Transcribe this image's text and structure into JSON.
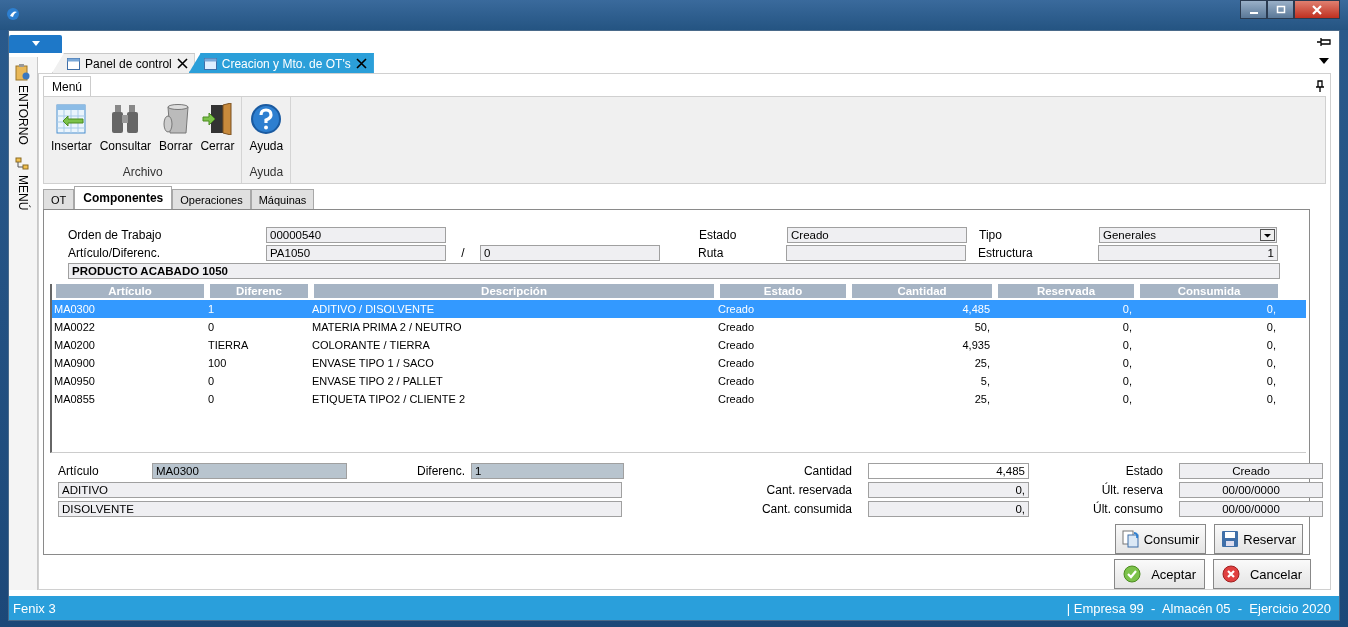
{
  "sidebar": {
    "items": [
      {
        "label": "ENTORNO"
      },
      {
        "label": "MENÚ"
      }
    ]
  },
  "document_tabs": [
    {
      "label": "Panel de control",
      "selected": false
    },
    {
      "label": "Creacion y Mto. de OT's",
      "selected": true
    }
  ],
  "ribbon": {
    "tab": "Menú",
    "groups": [
      {
        "label": "Archivo",
        "buttons": [
          {
            "label": "Insertar"
          },
          {
            "label": "Consultar"
          },
          {
            "label": "Borrar"
          },
          {
            "label": "Cerrar"
          }
        ]
      },
      {
        "label": "Ayuda",
        "buttons": [
          {
            "label": "Ayuda"
          }
        ]
      }
    ]
  },
  "form_tabs": [
    {
      "label": "OT",
      "selected": false
    },
    {
      "label": "Componentes",
      "selected": true
    },
    {
      "label": "Operaciones",
      "selected": false
    },
    {
      "label": "Máquinas",
      "selected": false
    }
  ],
  "header": {
    "orden_label": "Orden de Trabajo",
    "orden": "00000540",
    "articulo_label": "Artículo/Diferenc.",
    "articulo": "PA1050",
    "separator": "/",
    "diferenc": "0",
    "estado_label": "Estado",
    "estado": "Creado",
    "ruta_label": "Ruta",
    "tipo_label": "Tipo",
    "tipo": "Generales",
    "estructura_label": "Estructura",
    "estructura": "1",
    "descripcion": "PRODUCTO ACABADO 1050"
  },
  "table": {
    "columns": [
      "Artículo",
      "Diferenc",
      "Descripción",
      "Estado",
      "Cantidad",
      "Reservada",
      "Consumida"
    ],
    "rows": [
      {
        "selected": true,
        "cells": [
          "MA0300",
          "1",
          "ADITIVO / DISOLVENTE",
          "Creado",
          "4,485",
          "0,",
          "0,"
        ]
      },
      {
        "selected": false,
        "cells": [
          "MA0022",
          "0",
          "MATERIA PRIMA 2 / NEUTRO",
          "Creado",
          "50,",
          "0,",
          "0,"
        ]
      },
      {
        "selected": false,
        "cells": [
          "MA0200",
          "TIERRA",
          "COLORANTE / TIERRA",
          "Creado",
          "4,935",
          "0,",
          "0,"
        ]
      },
      {
        "selected": false,
        "cells": [
          "MA0900",
          "100",
          "ENVASE TIPO 1 / SACO",
          "Creado",
          "25,",
          "0,",
          "0,"
        ]
      },
      {
        "selected": false,
        "cells": [
          "MA0950",
          "0",
          "ENVASE TIPO 2 / PALLET",
          "Creado",
          "5,",
          "0,",
          "0,"
        ]
      },
      {
        "selected": false,
        "cells": [
          "MA0855",
          "0",
          "ETIQUETA TIPO2 / CLIENTE 2",
          "Creado",
          "25,",
          "0,",
          "0,"
        ]
      }
    ]
  },
  "detail": {
    "articulo_label": "Artículo",
    "articulo": "MA0300",
    "diferenc_label": "Diferenc.",
    "diferenc": "1",
    "line_1": "ADITIVO",
    "line_2": "DISOLVENTE",
    "cantidad_label": "Cantidad",
    "cantidad": "4,485",
    "reservada_label": "Cant. reservada",
    "reservada": "0,",
    "consumida_label": "Cant. consumida",
    "consumida": "0,",
    "estado_label": "Estado",
    "estado": "Creado",
    "ult_reserva_label": "Últ. reserva",
    "ult_reserva": "00/00/0000",
    "ult_consumo_label": "Últ. consumo",
    "ult_consumo": "00/00/0000"
  },
  "panel_buttons": [
    {
      "label": "Consumir"
    },
    {
      "label": "Reservar"
    }
  ],
  "dialog_buttons": [
    {
      "label": "Aceptar"
    },
    {
      "label": "Cancelar"
    }
  ],
  "status_bar": {
    "left": "Fenix 3",
    "right": "| Empresa 99  -  Almacén 05  -  Ejercicio 2020"
  }
}
